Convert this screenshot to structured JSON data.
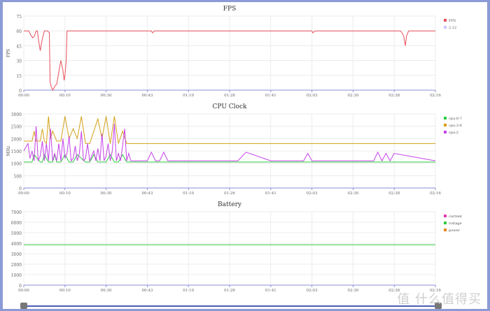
{
  "watermark": "值 什么值得买",
  "chart_data": [
    {
      "type": "line",
      "title": "FPS",
      "ylabel": "FPS",
      "ylim": [
        0,
        75
      ],
      "y_ticks": [
        0,
        15,
        30,
        45,
        60,
        75
      ],
      "x_ticks": [
        "00:00",
        "00:10",
        "00:30",
        "00:43",
        "01:10",
        "01:26",
        "01:41",
        "02:03",
        "02:30",
        "02:38",
        "02:16"
      ],
      "xlim": [
        0,
        1000
      ],
      "legend": [
        {
          "name": "FPS",
          "color": "#e8505b"
        },
        {
          "name": "2.12",
          "color": "#c9c9ff"
        }
      ],
      "series": [
        {
          "name": "FPS",
          "color": "#e8505b",
          "x": [
            0,
            12,
            18,
            22,
            26,
            30,
            33,
            36,
            40,
            44,
            50,
            58,
            62,
            64,
            67,
            70,
            73,
            75,
            80,
            90,
            95,
            98,
            100,
            103,
            105,
            110,
            115,
            120,
            250,
            310,
            311,
            313,
            315,
            318,
            700,
            702,
            705,
            708,
            900,
            915,
            919,
            923,
            927,
            930,
            935,
            940,
            1000
          ],
          "y": [
            60,
            60,
            55,
            53,
            55,
            60,
            60,
            50,
            40,
            50,
            60,
            60,
            58,
            8,
            3,
            0,
            2,
            4,
            6,
            30,
            20,
            10,
            15,
            30,
            60,
            60,
            60,
            60,
            60,
            60,
            59,
            58,
            59,
            60,
            60,
            58,
            59,
            60,
            60,
            60,
            58,
            55,
            45,
            55,
            60,
            60,
            60
          ]
        }
      ]
    },
    {
      "type": "line",
      "title": "CPU Clock",
      "ylabel": "MHz",
      "ylim": [
        0,
        3000
      ],
      "y_ticks": [
        0,
        500,
        1000,
        1500,
        2000,
        2500,
        3000
      ],
      "x_ticks": [
        "00:00",
        "00:10",
        "00:30",
        "00:43",
        "01:10",
        "01:26",
        "01:41",
        "02:03",
        "02:30",
        "02:38",
        "02:16"
      ],
      "xlim": [
        0,
        1000
      ],
      "legend": [
        {
          "name": "cpu:0-7",
          "color": "#2ecc40"
        },
        {
          "name": "cpu:3-6",
          "color": "#d4a017"
        },
        {
          "name": "cpu:2",
          "color": "#c542e8"
        }
      ],
      "series": [
        {
          "name": "cpu:0-7",
          "color": "#2ecc40",
          "x": [
            0,
            20,
            25,
            40,
            45,
            50,
            60,
            70,
            75,
            80,
            90,
            100,
            110,
            120,
            130,
            150,
            160,
            170,
            180,
            200,
            210,
            220,
            230,
            240,
            250,
            1000
          ],
          "y": [
            1050,
            1050,
            1350,
            1050,
            1050,
            1350,
            1050,
            1050,
            1350,
            1050,
            1050,
            1350,
            1050,
            1050,
            1350,
            1050,
            1050,
            1350,
            1050,
            1050,
            1350,
            1050,
            1050,
            1350,
            1050,
            1050
          ]
        },
        {
          "name": "cpu:3-6",
          "color": "#d4a017",
          "x": [
            0,
            20,
            25,
            30,
            40,
            45,
            50,
            55,
            60,
            65,
            70,
            80,
            90,
            100,
            110,
            120,
            130,
            140,
            150,
            160,
            170,
            180,
            190,
            200,
            210,
            220,
            230,
            240,
            250,
            1000
          ],
          "y": [
            1900,
            1900,
            2300,
            1900,
            1900,
            2400,
            1900,
            1800,
            2900,
            2000,
            2300,
            1900,
            1900,
            2900,
            2000,
            2400,
            2000,
            2900,
            1800,
            1800,
            2300,
            2800,
            2000,
            2900,
            1800,
            2900,
            1800,
            2300,
            1800,
            1800
          ]
        },
        {
          "name": "cpu:2",
          "color": "#c542e8",
          "x": [
            0,
            10,
            15,
            20,
            25,
            30,
            35,
            40,
            45,
            50,
            55,
            60,
            65,
            70,
            75,
            80,
            85,
            90,
            95,
            100,
            105,
            110,
            115,
            120,
            125,
            130,
            135,
            140,
            145,
            150,
            155,
            160,
            165,
            170,
            175,
            180,
            185,
            190,
            195,
            200,
            205,
            210,
            215,
            220,
            225,
            230,
            235,
            240,
            245,
            250,
            255,
            260,
            300,
            310,
            320,
            330,
            340,
            350,
            400,
            520,
            540,
            600,
            680,
            690,
            700,
            850,
            860,
            870,
            880,
            890,
            900,
            1000
          ],
          "y": [
            1500,
            1800,
            1200,
            1500,
            1100,
            2500,
            1100,
            1300,
            1900,
            1100,
            1800,
            1100,
            2400,
            1100,
            1400,
            1100,
            1800,
            1100,
            2000,
            1200,
            1400,
            2100,
            1100,
            1200,
            1700,
            1100,
            1400,
            2300,
            1100,
            1200,
            1800,
            1100,
            1300,
            1500,
            1100,
            1600,
            1100,
            2200,
            1100,
            1300,
            1800,
            1100,
            1500,
            2600,
            1100,
            1400,
            1100,
            1700,
            2400,
            1100,
            1400,
            1100,
            1100,
            1450,
            1100,
            1100,
            1450,
            1100,
            1100,
            1100,
            1450,
            1100,
            1100,
            1400,
            1100,
            1100,
            1450,
            1100,
            1400,
            1100,
            1400,
            1100
          ]
        }
      ]
    },
    {
      "type": "line",
      "title": "Battery",
      "ylabel": "",
      "ylim": [
        0,
        7000
      ],
      "y_ticks": [
        0,
        1000,
        2000,
        3000,
        4000,
        5000,
        6000,
        7000
      ],
      "x_ticks": [
        "00:00",
        "00:10",
        "00:30",
        "00:43",
        "01:10",
        "01:26",
        "01:41",
        "02:03",
        "02:30",
        "02:38",
        "02:16"
      ],
      "xlim": [
        0,
        1000
      ],
      "legend": [
        {
          "name": "current",
          "color": "#e23ab0"
        },
        {
          "name": "voltage",
          "color": "#2ecc40"
        },
        {
          "name": "power",
          "color": "#e08a1e"
        }
      ],
      "series": [
        {
          "name": "voltage",
          "color": "#2ecc40",
          "x": [
            0,
            1000
          ],
          "y": [
            3850,
            3850
          ]
        }
      ]
    }
  ]
}
